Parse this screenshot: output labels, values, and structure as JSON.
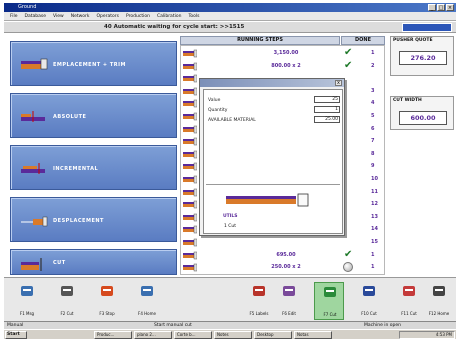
{
  "window": {
    "title": "Ground",
    "controls": [
      "_",
      "□",
      "×"
    ]
  },
  "menu": [
    "File",
    "Database",
    "View",
    "Network",
    "Operators",
    "Production",
    "Calibration",
    "Tools"
  ],
  "status_message": "40 Automatic waiting for cycle start: >>1515",
  "modes": [
    {
      "label": "EMPLACEMENT + TRIM"
    },
    {
      "label": "ABSOLUTE"
    },
    {
      "label": "INCREMENTAL"
    },
    {
      "label": "DESPLACEMENT"
    },
    {
      "label": "CUT"
    }
  ],
  "steps_panel": {
    "header": "RUNNING STEPS",
    "done_header": "DONE",
    "rows": [
      {
        "value": "3,150.00",
        "done": "check",
        "count": "1"
      },
      {
        "value": "800.00 x 2",
        "done": "check",
        "count": "2"
      },
      {
        "value": "",
        "done": "",
        "count": ""
      },
      {
        "value": "",
        "done": "",
        "count": "3"
      },
      {
        "value": "",
        "done": "",
        "count": "4"
      },
      {
        "value": "",
        "done": "",
        "count": "5"
      },
      {
        "value": "",
        "done": "",
        "count": "6"
      },
      {
        "value": "",
        "done": "",
        "count": "7"
      },
      {
        "value": "",
        "done": "",
        "count": "8"
      },
      {
        "value": "",
        "done": "",
        "count": "9"
      },
      {
        "value": "",
        "done": "",
        "count": "10"
      },
      {
        "value": "",
        "done": "",
        "count": "11"
      },
      {
        "value": "",
        "done": "",
        "count": "12"
      },
      {
        "value": "",
        "done": "",
        "count": "13"
      },
      {
        "value": "",
        "done": "",
        "count": "14"
      },
      {
        "value": "",
        "done": "",
        "count": "15"
      },
      {
        "value": "695.00",
        "done": "check",
        "count": "1"
      },
      {
        "value": "250.00 x 2",
        "done": "circle",
        "count": "1"
      }
    ]
  },
  "dialog": {
    "close": "x",
    "fields": [
      {
        "label": "Value",
        "value": "25"
      },
      {
        "label": "Quantity",
        "value": "1"
      },
      {
        "label": "AVAILABLE MATERIAL",
        "value": "25.00"
      }
    ],
    "label_a": "UTILS",
    "label_b": "1 Cut"
  },
  "pusher": {
    "header": "PUSHER QUOTE",
    "value": "276.20"
  },
  "cut_width": {
    "header": "CUT WIDTH",
    "value": "600.00"
  },
  "fkeys": [
    {
      "label": "F1 Msg",
      "icon": "wrench-icon"
    },
    {
      "label": "F2 Cut",
      "icon": "printer-icon"
    },
    {
      "label": "F3 Stop",
      "icon": "stop-icon"
    },
    {
      "label": "F4 Home",
      "icon": "home-axis-icon"
    },
    {
      "label": "F5 Labels",
      "icon": "labels-icon"
    },
    {
      "label": "F6 Edit",
      "icon": "calculator-icon"
    },
    {
      "label": "F7 Cut",
      "icon": "cut-icon"
    },
    {
      "label": "F10 Cut",
      "icon": "cut-list-icon"
    },
    {
      "label": "F11 Cut",
      "icon": "cut-alt-icon"
    },
    {
      "label": "F12 Home",
      "icon": "house-icon"
    }
  ],
  "statusbar": {
    "left": "Manual",
    "middle": "Start manual cut",
    "right": "Machine in open"
  },
  "taskbar": {
    "start": "Start",
    "buttons": [
      "Produc...",
      "plano 2...",
      "Corte b...",
      "Notes",
      "Desktop",
      "Notas"
    ],
    "clock": "4:53 PM"
  }
}
